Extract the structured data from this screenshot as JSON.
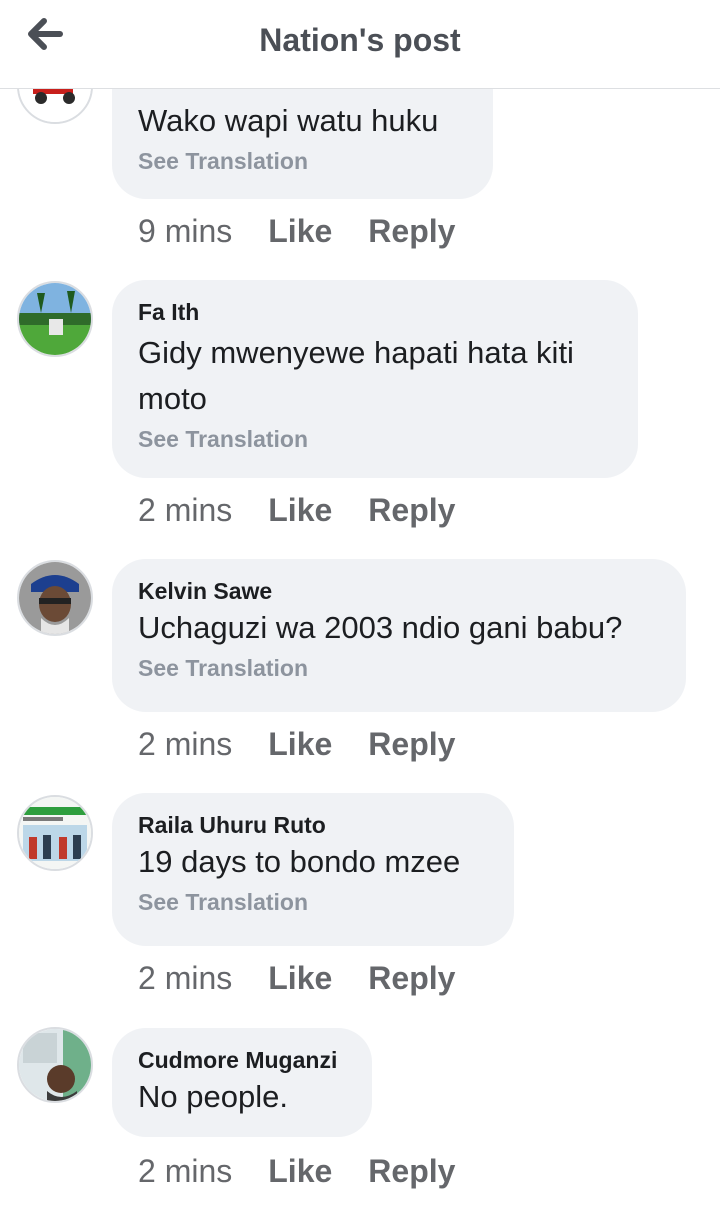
{
  "header": {
    "title": "Nation's post"
  },
  "comments": [
    {
      "author": "",
      "text": "Wako wapi watu huku",
      "translate": "See Translation",
      "time": "9 mins",
      "like": "Like",
      "reply": "Reply"
    },
    {
      "author": "Fa Ith",
      "text": "Gidy mwenyewe hapati hata kiti moto",
      "translate": "See Translation",
      "time": "2 mins",
      "like": "Like",
      "reply": "Reply"
    },
    {
      "author": "Kelvin Sawe",
      "text": "Uchaguzi wa 2003 ndio gani babu?",
      "translate": "See Translation",
      "time": "2 mins",
      "like": "Like",
      "reply": "Reply"
    },
    {
      "author": "Raila Uhuru Ruto",
      "text": "19 days to bondo mzee",
      "translate": "See Translation",
      "time": "2 mins",
      "like": "Like",
      "reply": "Reply"
    },
    {
      "author": "Cudmore Muganzi",
      "text": "No people.",
      "translate": "",
      "time": "2 mins",
      "like": "Like",
      "reply": "Reply"
    }
  ],
  "icons": {
    "back": "arrow-left-icon"
  },
  "colors": {
    "bubble": "#f0f2f5",
    "secondary_text": "#65676b",
    "translate_text": "#8d949e"
  }
}
